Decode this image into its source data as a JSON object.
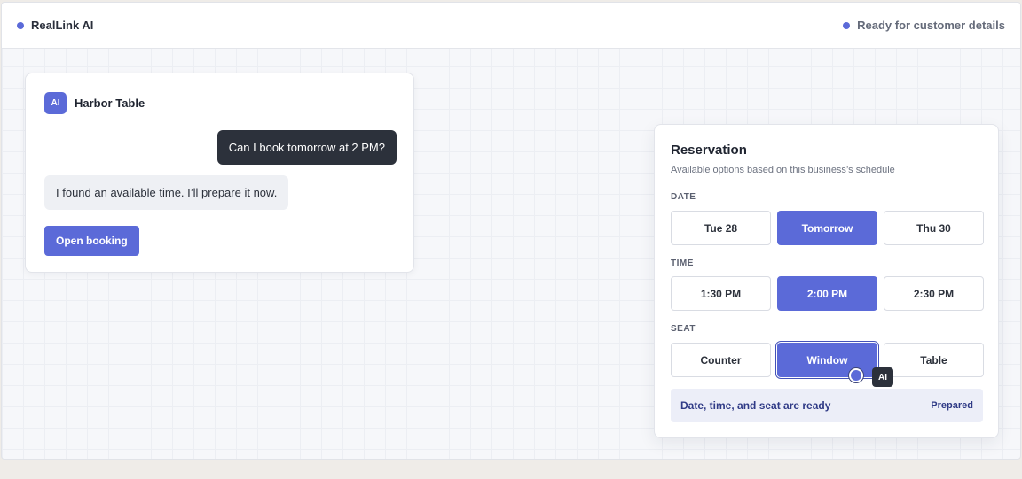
{
  "header": {
    "brand": "RealLink AI",
    "status": "Ready for customer details",
    "accent_color": "#5b6ad8"
  },
  "chat": {
    "badge": "AI",
    "title": "Harbor Table",
    "user_message": "Can I book tomorrow at 2 PM?",
    "ai_message": "I found an available time. I’ll prepare it now.",
    "open_button": "Open booking"
  },
  "reservation": {
    "title": "Reservation",
    "subtitle": "Available options based on this business’s schedule",
    "date": {
      "label": "DATE",
      "options": [
        "Tue 28",
        "Tomorrow",
        "Thu 30"
      ],
      "selected": "Tomorrow"
    },
    "time": {
      "label": "TIME",
      "options": [
        "1:30 PM",
        "2:00 PM",
        "2:30 PM"
      ],
      "selected": "2:00 PM"
    },
    "seat": {
      "label": "SEAT",
      "options": [
        "Counter",
        "Window",
        "Table"
      ],
      "selected": "Window"
    },
    "ready_text": "Date, time, and seat are ready",
    "ready_tag": "Prepared"
  },
  "cursor": {
    "label": "AI",
    "icon": "cursor-dot-icon"
  }
}
